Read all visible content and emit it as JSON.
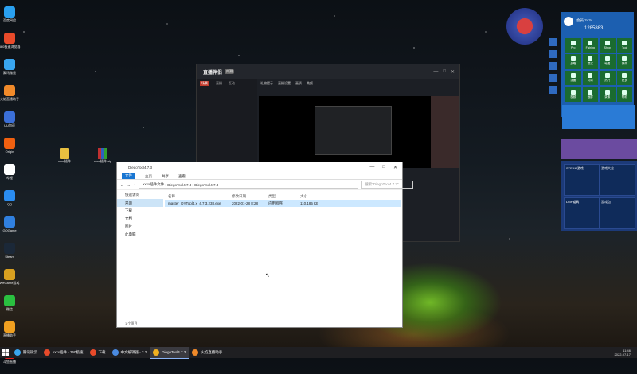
{
  "desktop": {
    "icons": [
      {
        "label": "百度网盘",
        "color": "#2aa0f0"
      },
      {
        "label": "360极速浏览器",
        "color": "#e84a2a"
      },
      {
        "label": "腾讯微云",
        "color": "#39a6f0"
      },
      {
        "label": "火焰直播助手",
        "color": "#f08a2a"
      },
      {
        "label": "UU加速",
        "color": "#3b6fd8"
      },
      {
        "label": "Origin",
        "color": "#f06010"
      },
      {
        "label": "哔哩",
        "color": "#ffffff"
      },
      {
        "label": "QQ",
        "color": "#2a8cf0"
      },
      {
        "label": "GOGame",
        "color": "#3080e0"
      },
      {
        "label": "Steam",
        "color": "#1b2838"
      },
      {
        "label": "WeGame游戏",
        "color": "#d8a020"
      },
      {
        "label": "微信",
        "color": "#2ac040"
      },
      {
        "label": "直播助手",
        "color": "#f0a020"
      },
      {
        "label": "斗鱼直播",
        "color": "#e02020"
      }
    ],
    "file_folder": "xxxx插件",
    "file_archive": "xxxx插件.zip"
  },
  "stream_app": {
    "logo": "直播伴侣",
    "logo_sub": "内测",
    "tabs": [
      "场景",
      "直播",
      "互动"
    ],
    "header_items": [
      "礼物提示",
      "直播设置",
      "画质",
      "美颜"
    ],
    "left_label": "工具箱"
  },
  "explorer": {
    "title": "DiegoTool4.7.3",
    "ribbon": {
      "file": "文件",
      "home": "主页",
      "share": "共享",
      "view": "查看"
    },
    "address": [
      "xxxx插件文件",
      "DiegoTool4.7.3",
      "DiegoTool4.7.3"
    ],
    "search_placeholder": "搜索\"DiegoTool4.7.3\"",
    "nav": [
      "快速访问",
      "桌面",
      "下载",
      "文档",
      "图片",
      "此电脑"
    ],
    "columns": {
      "name": "名称",
      "date": "修改日期",
      "type": "类型",
      "size": "大小"
    },
    "rows": [
      {
        "name": "master_DYTool4.x_4.7.3.238.exe",
        "date": "2022-01-28 8:28",
        "type": "应用程序",
        "size": "110,185 KB"
      }
    ],
    "status": "1 个项目"
  },
  "widgets": {
    "dash_user": "会员 2434",
    "dash_id": "1285883",
    "dash_cells": [
      "Pro",
      "Fishing",
      "Shop",
      "Tool",
      "战略",
      "模式",
      "地图",
      "弹药",
      "设置",
      "对局",
      "热门",
      "更多",
      "视频",
      "截屏",
      "录像",
      "帮助"
    ],
    "steam_cards": [
      "STEAM游戏",
      "游戏大全",
      "DNF道具",
      "游戏包"
    ]
  },
  "taskbar": {
    "items": [
      {
        "label": "腾讯微云",
        "color": "#39a6f0",
        "active": false
      },
      {
        "label": "xxxx插件 - 360极速",
        "color": "#e84a2a",
        "active": false
      },
      {
        "label": "下载",
        "color": "#e84a2a",
        "active": false
      },
      {
        "label": "中文编辑器 - 2.2",
        "color": "#4a8ae0",
        "active": false
      },
      {
        "label": "DiegoTool4.7.3",
        "color": "#f0b020",
        "active": true
      },
      {
        "label": "火焰直播助手",
        "color": "#f08a2a",
        "active": false
      }
    ],
    "time": "11:46",
    "date": "2022-07-17"
  }
}
